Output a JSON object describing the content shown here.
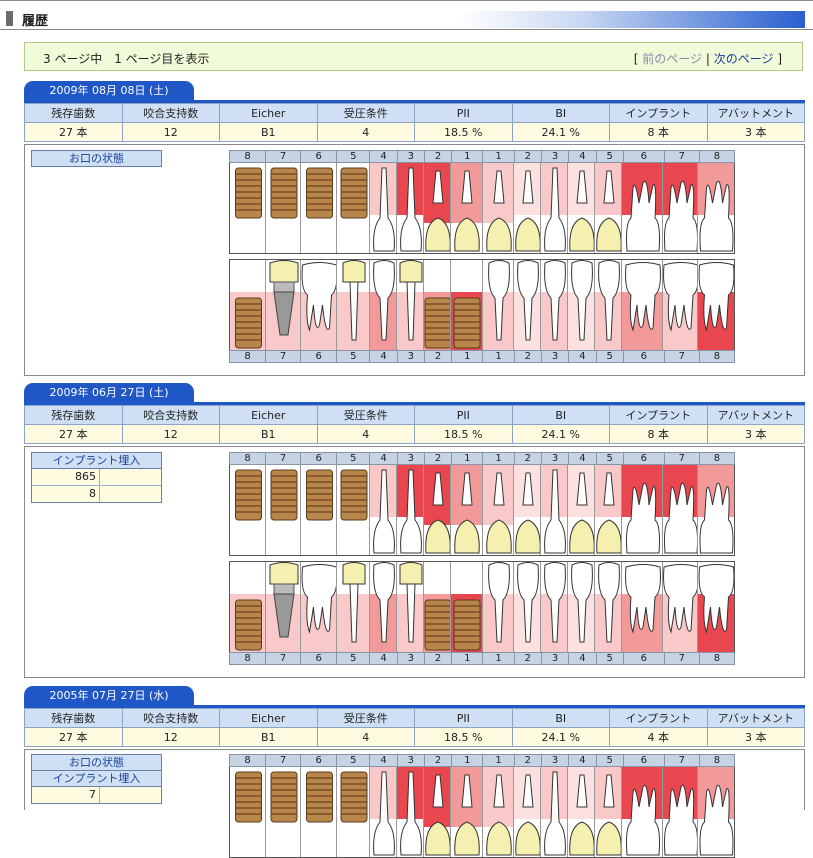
{
  "header": {
    "title": "履歴"
  },
  "pager": {
    "info": "3 ページ中　1 ページ目を表示",
    "prev": "前のページ",
    "sep": "|",
    "next": "次のページ",
    "open": "[",
    "close": "]"
  },
  "columns": [
    "残存歯数",
    "咬合支持数",
    "Eicher",
    "受圧条件",
    "PII",
    "BI",
    "インプラント",
    "アバットメント"
  ],
  "records": [
    {
      "date": "2009年 08月 08日 (土)",
      "values": [
        "27 本",
        "12",
        "B1",
        "4",
        "18.5 %",
        "24.1 %",
        "8 本",
        "3 本"
      ],
      "side_title": "お口の状態",
      "side_rows": []
    },
    {
      "date": "2009年 06月 27日 (土)",
      "values": [
        "27 本",
        "12",
        "B1",
        "4",
        "18.5 %",
        "24.1 %",
        "8 本",
        "3 本"
      ],
      "side_title": "インプラント埋入",
      "side_rows": [
        [
          "865",
          ""
        ],
        [
          "8",
          ""
        ]
      ]
    },
    {
      "date": "2005年 07月 27日 (水)",
      "values": [
        "27 本",
        "12",
        "B1",
        "4",
        "18.5 %",
        "24.1 %",
        "4 本",
        "3 本"
      ],
      "side_title": "お口の状態",
      "side_title2": "インプラント埋入",
      "side_rows": [
        [
          "7",
          ""
        ]
      ]
    }
  ],
  "tooth_numbers": [
    "8",
    "7",
    "6",
    "5",
    "4",
    "3",
    "2",
    "1",
    "1",
    "2",
    "3",
    "4",
    "5",
    "6",
    "7",
    "8"
  ],
  "colors": {
    "blue": "#1f57c6",
    "header_bg": "#cfe0f4",
    "value_bg": "#fffbe0",
    "pink_light": "#f9c9c9",
    "pink_mid": "#f29a9a",
    "red": "#e8474f",
    "gold": "#b8864a"
  },
  "upper_types": [
    "implant",
    "implant",
    "implant",
    "implant",
    "root",
    "root",
    "crown",
    "crown",
    "crown",
    "crown",
    "root",
    "crown",
    "crown",
    "molar",
    "molar",
    "molar"
  ],
  "lower_types": [
    "implant",
    "implant-crown",
    "molar",
    "crown",
    "root",
    "crown",
    "implant",
    "implant",
    "root",
    "root",
    "root",
    "root",
    "root",
    "molar",
    "molar",
    "molar"
  ]
}
